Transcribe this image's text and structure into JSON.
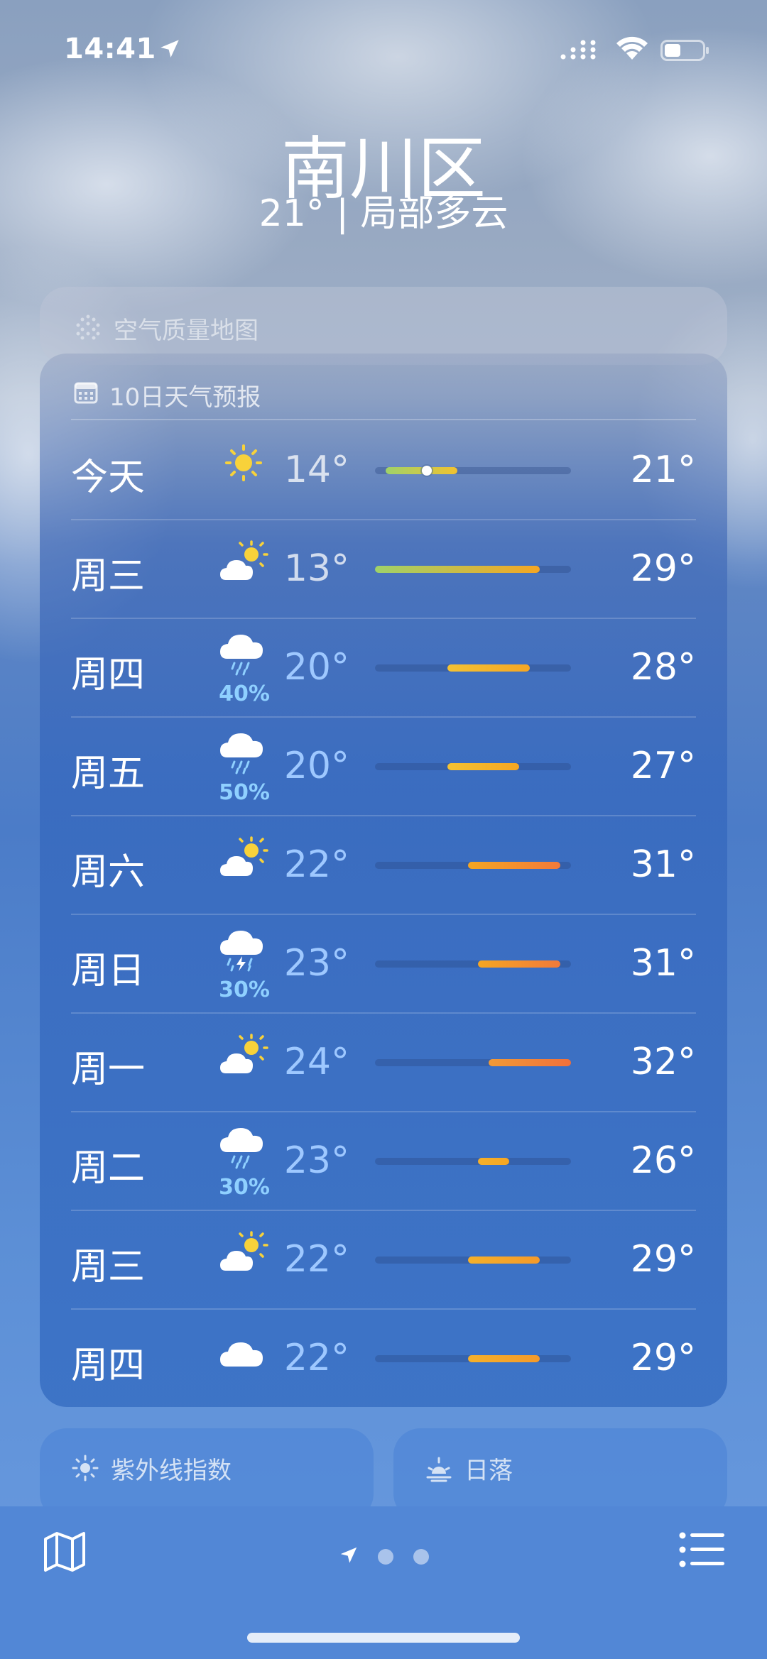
{
  "status_bar": {
    "time": "14:41",
    "icons": [
      "location-arrow-icon",
      "cellular-signal-icon",
      "wifi-icon",
      "battery-icon"
    ]
  },
  "header": {
    "city": "南川区",
    "summary": "21° | 局部多云"
  },
  "air_quality": {
    "label": "空气质量地图",
    "icon": "air-quality-dots-icon"
  },
  "forecast": {
    "title": "10日天气预报",
    "icon": "calendar-icon",
    "days": [
      {
        "day": "今天",
        "icon": "sun",
        "pop": "",
        "low": "14°",
        "high": "21°",
        "low_val": 14,
        "high_val": 21,
        "current_val": 18,
        "color_start": "#9fd26a",
        "color_end": "#f2c230"
      },
      {
        "day": "周三",
        "icon": "partly-cloudy",
        "pop": "",
        "low": "13°",
        "high": "29°",
        "low_val": 13,
        "high_val": 29,
        "color_start": "#9fd26a",
        "color_end": "#f5a623"
      },
      {
        "day": "周四",
        "icon": "rain",
        "pop": "40%",
        "low": "20°",
        "high": "28°",
        "low_val": 20,
        "high_val": 28,
        "color_start": "#f4c233",
        "color_end": "#f5a623"
      },
      {
        "day": "周五",
        "icon": "rain",
        "pop": "50%",
        "low": "20°",
        "high": "27°",
        "low_val": 20,
        "high_val": 27,
        "color_start": "#f4c233",
        "color_end": "#f5a623"
      },
      {
        "day": "周六",
        "icon": "partly-cloudy",
        "pop": "",
        "low": "22°",
        "high": "31°",
        "low_val": 22,
        "high_val": 31,
        "color_start": "#f5a623",
        "color_end": "#f27a3a"
      },
      {
        "day": "周日",
        "icon": "thunderstorm",
        "pop": "30%",
        "low": "23°",
        "high": "31°",
        "low_val": 23,
        "high_val": 31,
        "color_start": "#f5a623",
        "color_end": "#f27a3a"
      },
      {
        "day": "周一",
        "icon": "partly-cloudy",
        "pop": "",
        "low": "24°",
        "high": "32°",
        "low_val": 24,
        "high_val": 32,
        "color_start": "#f29a36",
        "color_end": "#f2703a"
      },
      {
        "day": "周二",
        "icon": "rain",
        "pop": "30%",
        "low": "23°",
        "high": "26°",
        "low_val": 23,
        "high_val": 26,
        "color_start": "#f5b02a",
        "color_end": "#f5a623"
      },
      {
        "day": "周三",
        "icon": "partly-cloudy",
        "pop": "",
        "low": "22°",
        "high": "29°",
        "low_val": 22,
        "high_val": 29,
        "color_start": "#f5b02a",
        "color_end": "#f59a2a"
      },
      {
        "day": "周四",
        "icon": "cloudy",
        "pop": "",
        "low": "22°",
        "high": "29°",
        "low_val": 22,
        "high_val": 29,
        "color_start": "#f5b02a",
        "color_end": "#f59a2a"
      }
    ],
    "range_min": 13,
    "range_max": 32
  },
  "uv_card": {
    "label": "紫外线指数",
    "icon": "sun-small-icon"
  },
  "sunset_card": {
    "label": "日落",
    "icon": "sunset-icon"
  },
  "toolbar": {
    "map_icon": "map-icon",
    "list_icon": "list-icon",
    "page_count": 3,
    "current_page": 0
  }
}
